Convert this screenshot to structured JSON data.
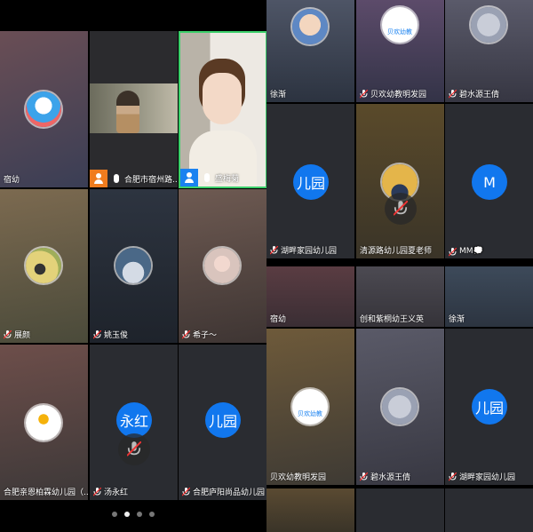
{
  "left": {
    "tiles": [
      {
        "name": "宿幼"
      },
      {
        "name": "合肥市宿州路..."
      },
      {
        "name": "盛梅菊"
      },
      {
        "name": "展颜"
      },
      {
        "name": "姚玉俊"
      },
      {
        "name": "希子～"
      },
      {
        "name": "合肥亲恩柏霖幼儿园（..."
      },
      {
        "name": "汤永红",
        "avatar_text": "永红"
      },
      {
        "name": "合肥庐阳尚品幼儿园",
        "avatar_text": "儿园"
      }
    ],
    "pages": 4,
    "active_page": 2
  },
  "right": {
    "tiles": [
      {
        "name": "徐渐"
      },
      {
        "name": "贝欢幼教明发园",
        "logo_text": "贝欢幼教"
      },
      {
        "name": "碧水源王倩"
      },
      {
        "name": "湖畔家园幼儿园",
        "avatar_text": "儿园"
      },
      {
        "name": "清源路幼儿园夏老师"
      },
      {
        "name": "MM💭",
        "avatar_text": "M"
      },
      {
        "name": "宿幼"
      },
      {
        "name": "创和紫桐幼王义英"
      },
      {
        "name": "徐渐"
      },
      {
        "name": "贝欢幼教明发园",
        "logo_text": "贝欢幼教"
      },
      {
        "name": "碧水源王倩"
      },
      {
        "name": "湖畔家园幼儿园",
        "avatar_text": "儿园"
      }
    ]
  },
  "colors": {
    "accent": "#1177ee",
    "speaker_border": "#3ccf6a",
    "mic_orange": "#f07c1e",
    "mic_blue": "#1a82f0"
  },
  "icons": {
    "muted": "mic-off-icon",
    "mic": "mic-icon",
    "person": "person-icon"
  }
}
